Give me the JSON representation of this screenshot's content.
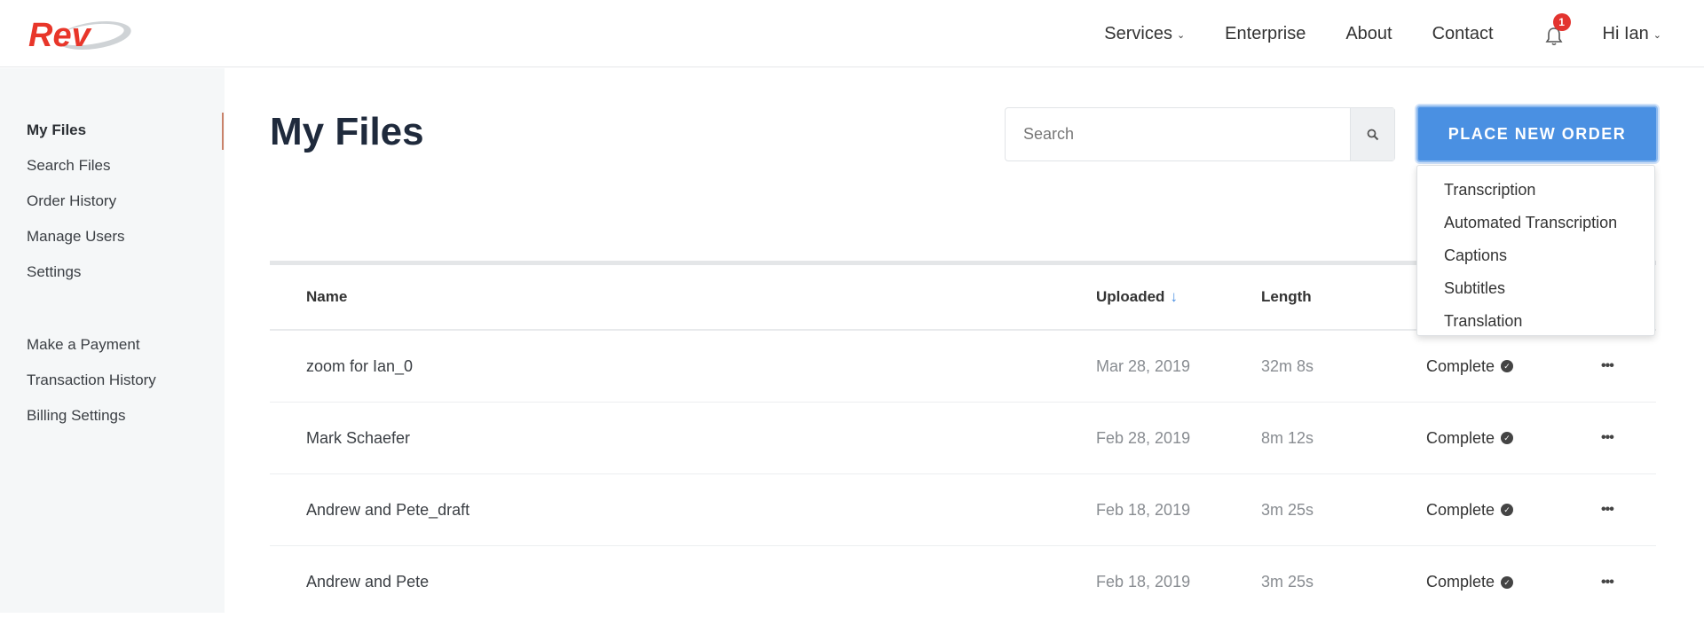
{
  "header": {
    "logo_text": "Rev",
    "nav": [
      {
        "label": "Services",
        "has_chevron": true
      },
      {
        "label": "Enterprise"
      },
      {
        "label": "About"
      },
      {
        "label": "Contact"
      }
    ],
    "notifications_count": "1",
    "user_menu": "Hi Ian"
  },
  "sidebar": {
    "primary": [
      {
        "label": "My Files",
        "active": true
      },
      {
        "label": "Search Files"
      },
      {
        "label": "Order History"
      },
      {
        "label": "Manage Users"
      },
      {
        "label": "Settings"
      }
    ],
    "billing": [
      {
        "label": "Make a Payment"
      },
      {
        "label": "Transaction History"
      },
      {
        "label": "Billing Settings"
      }
    ]
  },
  "main": {
    "title": "My Files",
    "search": {
      "placeholder": "Search",
      "value": ""
    },
    "order_button": "PLACE NEW ORDER",
    "order_menu": [
      "Transcription",
      "Automated Transcription",
      "Captions",
      "Subtitles",
      "Translation"
    ],
    "table": {
      "columns": {
        "name": "Name",
        "uploaded": "Uploaded",
        "length": "Length",
        "sort_indicator": "↓"
      },
      "rows": [
        {
          "name": "zoom for Ian_0",
          "uploaded": "Mar 28, 2019",
          "length": "32m 8s",
          "status": "Complete"
        },
        {
          "name": "Mark Schaefer",
          "uploaded": "Feb 28, 2019",
          "length": "8m 12s",
          "status": "Complete"
        },
        {
          "name": "Andrew and Pete_draft",
          "uploaded": "Feb 18, 2019",
          "length": "3m 25s",
          "status": "Complete"
        },
        {
          "name": "Andrew and Pete",
          "uploaded": "Feb 18, 2019",
          "length": "3m 25s",
          "status": "Complete"
        }
      ],
      "more_label": "•••"
    }
  },
  "colors": {
    "brand_red": "#e8362a",
    "accent_blue": "#4a90e2",
    "badge_red": "#e3342f"
  }
}
